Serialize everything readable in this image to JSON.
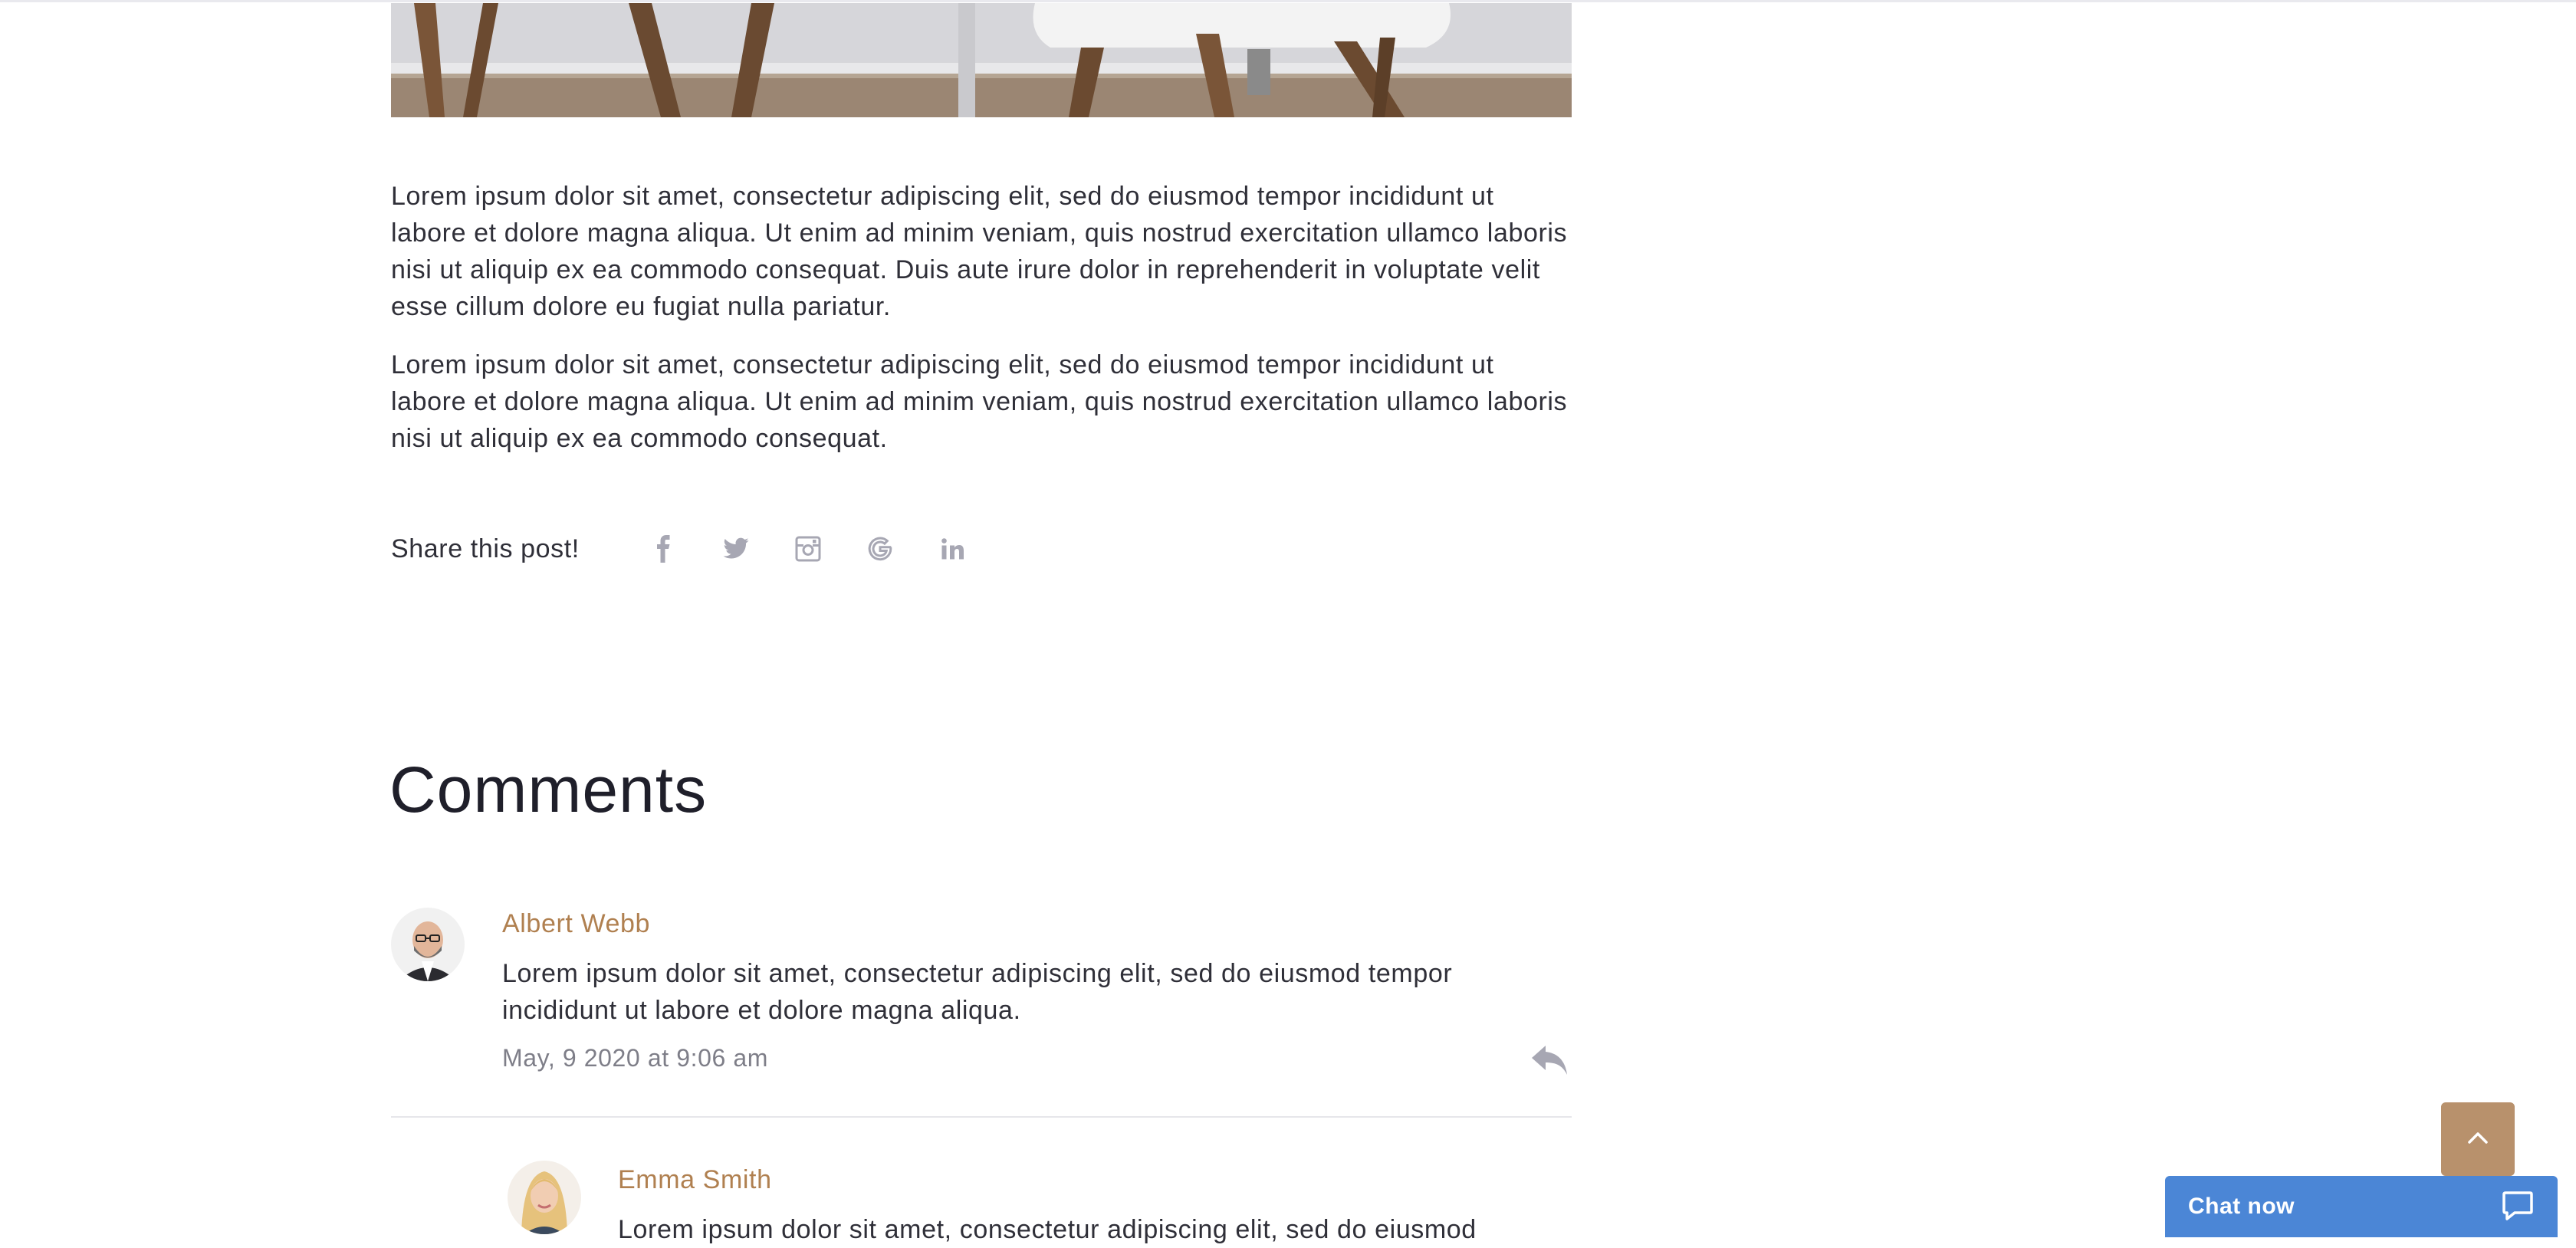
{
  "article": {
    "paragraphs": [
      "Lorem ipsum dolor sit amet, consectetur adipiscing elit, sed do eiusmod tempor incididunt ut labore et dolore magna aliqua. Ut enim ad minim veniam, quis nostrud exercitation ullamco laboris nisi ut aliquip ex ea commodo consequat. Duis aute irure dolor in reprehenderit in voluptate velit esse cillum dolore eu fugiat nulla pariatur.",
      "Lorem ipsum dolor sit amet, consectetur adipiscing elit, sed do eiusmod tempor incididunt ut labore et dolore magna aliqua. Ut enim ad minim veniam, quis nostrud exercitation ullamco laboris nisi ut aliquip ex ea commodo consequat."
    ]
  },
  "share": {
    "label": "Share this post!",
    "icons": [
      "facebook-icon",
      "twitter-icon",
      "instagram-icon",
      "google-icon",
      "linkedin-icon"
    ]
  },
  "comments": {
    "heading": "Comments",
    "items": [
      {
        "author": "Albert Webb",
        "text": "Lorem ipsum dolor sit amet, consectetur adipiscing elit, sed do eiusmod tempor incididunt ut labore et dolore magna aliqua.",
        "date": "May, 9 2020 at 9:06 am"
      },
      {
        "author": "Emma Smith",
        "text": "Lorem ipsum dolor sit amet, consectetur adipiscing elit, sed do eiusmod"
      }
    ]
  },
  "chat": {
    "label": "Chat now"
  },
  "colors": {
    "accent": "#b08050",
    "back_to_top": "#b8916c",
    "chat": "#4b86d6",
    "icon_gray": "#a7a7b3"
  }
}
